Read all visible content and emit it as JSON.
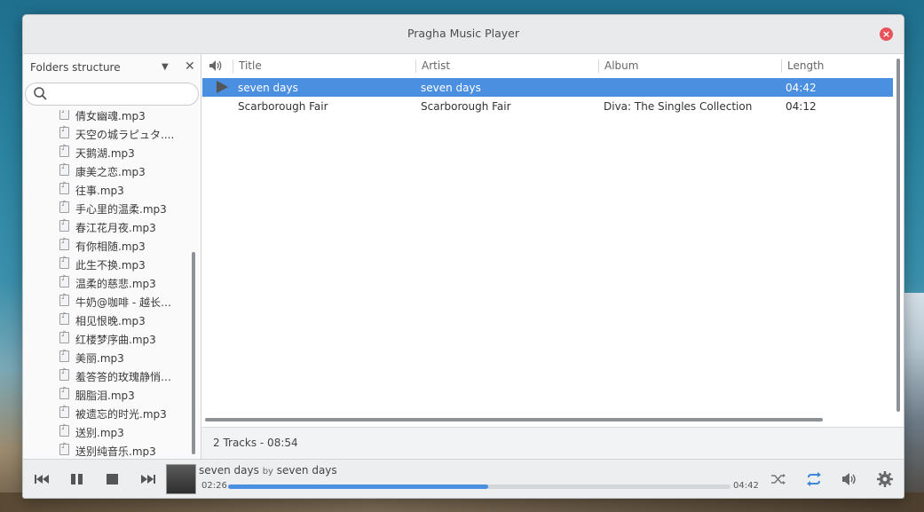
{
  "window": {
    "title": "Pragha Music Player"
  },
  "sidebar": {
    "header_label": "Folders structure",
    "search_placeholder": "",
    "files": [
      "倩女幽魂.mp3",
      "天空の城ラピュタ....",
      "天鹅湖.mp3",
      "康美之恋.mp3",
      "往事.mp3",
      "手心里的温柔.mp3",
      "春江花月夜.mp3",
      "有你相随.mp3",
      "此生不换.mp3",
      "温柔的慈悲.mp3",
      "牛奶@咖啡 - 越长大...",
      "相见恨晚.mp3",
      "红楼梦序曲.mp3",
      "美丽.mp3",
      "羞答答的玫瑰静悄悄...",
      "胭脂泪.mp3",
      "被遗忘的时光.mp3",
      "送别.mp3",
      "送别纯音乐.mp3"
    ]
  },
  "playlist": {
    "columns": {
      "title": "Title",
      "artist": "Artist",
      "album": "Album",
      "length": "Length"
    },
    "rows": [
      {
        "title": "seven days",
        "artist": "seven days",
        "album": "",
        "length": "04:42",
        "playing": true
      },
      {
        "title": "Scarborough Fair",
        "artist": "Scarborough Fair",
        "album": "Diva: The Singles Collection",
        "length": "04:12",
        "playing": false
      }
    ],
    "status": "2 Tracks - 08:54"
  },
  "player": {
    "track_title": "seven days",
    "by_label": "by",
    "track_artist": "seven days",
    "time_current": "02:26",
    "time_total": "04:42",
    "progress_fraction": 0.518
  },
  "colors": {
    "accent": "#4a8fe0",
    "close": "#e8535a"
  }
}
